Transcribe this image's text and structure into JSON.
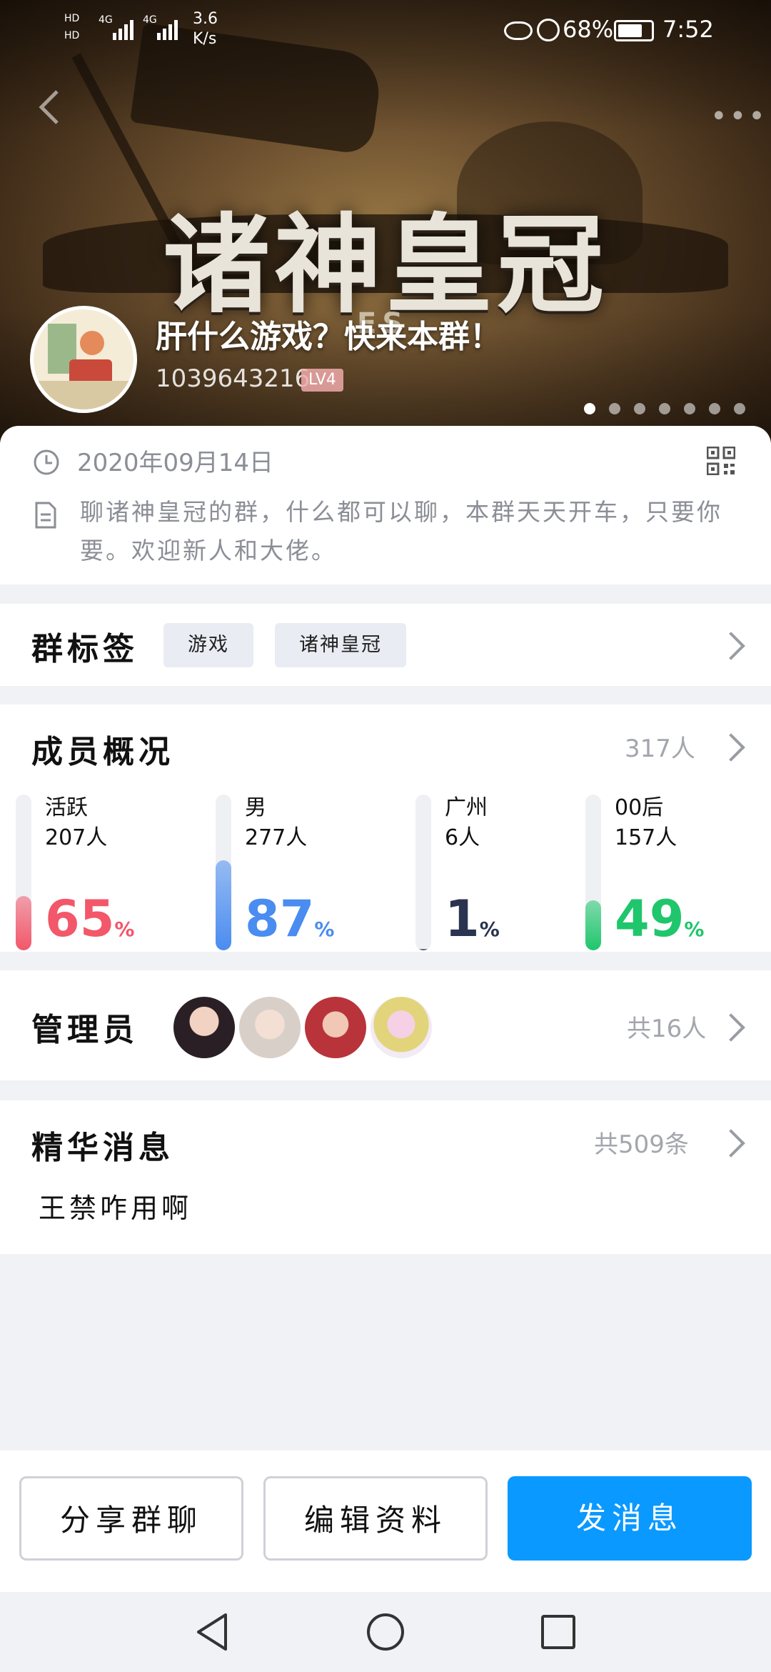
{
  "status_bar": {
    "network_speed_value": "3.6",
    "network_speed_unit": "K/s",
    "network_1": "4G",
    "network_2": "4G",
    "battery": "68%",
    "time": "7:52"
  },
  "banner": {
    "game_title": "诸神皇冠",
    "game_subtitle": "ES",
    "page_count": 7,
    "active_page": 0
  },
  "group": {
    "name": "肝什么游戏？快来本群！",
    "id": "1039643216",
    "level": "LV4",
    "created": "2020年09月14日",
    "description": "聊诸神皇冠的群，什么都可以聊，本群天天开车，只要你要。欢迎新人和大佬。"
  },
  "tags": {
    "title": "群标签",
    "items": [
      "游戏",
      "诸神皇冠"
    ]
  },
  "members": {
    "title": "成员概况",
    "total": "317人",
    "stats": [
      {
        "label": "活跃",
        "count": "207人",
        "percent": "65",
        "fill": 0.35,
        "color": "#f2576a"
      },
      {
        "label": "男",
        "count": "277人",
        "percent": "87",
        "fill": 0.58,
        "color": "#4a8cf0"
      },
      {
        "label": "广州",
        "count": "6人",
        "percent": "1",
        "fill": 0.01,
        "color": "#2a3450"
      },
      {
        "label": "00后",
        "count": "157人",
        "percent": "49",
        "fill": 0.32,
        "color": "#1fc66c"
      }
    ],
    "percent_sign": "%"
  },
  "admins": {
    "title": "管理员",
    "count": "共16人"
  },
  "essence": {
    "title": "精华消息",
    "count": "共509条",
    "preview": "王禁咋用啊"
  },
  "actions": {
    "share": "分享群聊",
    "edit": "编辑资料",
    "send": "发消息"
  }
}
